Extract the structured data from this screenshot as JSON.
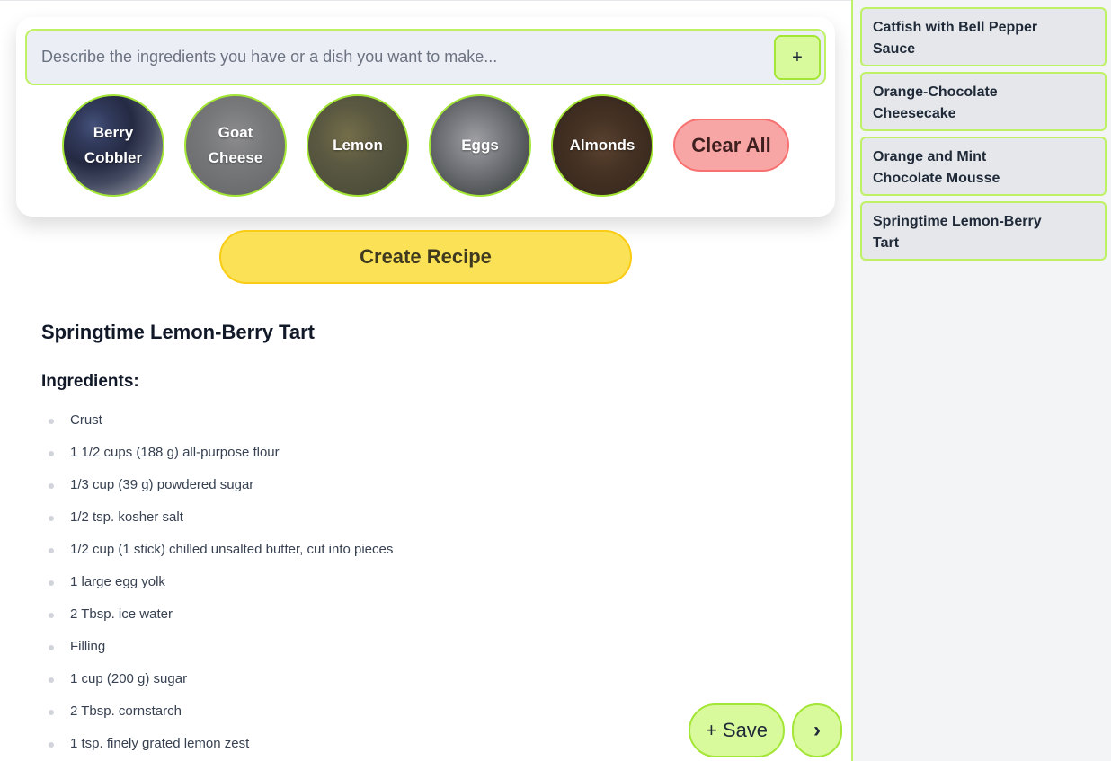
{
  "prompt": {
    "placeholder": "Describe the ingredients you have or a dish you want to make...",
    "add_label": "+"
  },
  "chips": [
    {
      "label": "Berry Cobbler",
      "icon": "berry-cobbler-photo"
    },
    {
      "label": "Goat Cheese",
      "icon": "goat-cheese-photo"
    },
    {
      "label": "Lemon",
      "icon": "lemon-photo"
    },
    {
      "label": "Eggs",
      "icon": "eggs-photo"
    },
    {
      "label": "Almonds",
      "icon": "almonds-photo"
    }
  ],
  "clear_all_label": "Clear All",
  "create_recipe_label": "Create Recipe",
  "recipe": {
    "title": "Springtime Lemon-Berry Tart",
    "ingredients_heading": "Ingredients:",
    "ingredients": [
      "Crust",
      "1 1/2 cups (188 g) all-purpose flour",
      "1/3 cup (39 g) powdered sugar",
      "1/2 tsp. kosher salt",
      "1/2 cup (1 stick) chilled unsalted butter, cut into pieces",
      "1 large egg yolk",
      "2 Tbsp. ice water",
      "Filling",
      "1 cup (200 g) sugar",
      "2 Tbsp. cornstarch",
      "1 tsp. finely grated lemon zest"
    ]
  },
  "actions": {
    "save_label": "+ Save",
    "next_label": "›"
  },
  "saved_recipes": [
    "Catfish with Bell Pepper Sauce",
    "Orange-Chocolate Cheesecake",
    "Orange and Mint Chocolate Mousse",
    "Springtime Lemon-Berry Tart"
  ],
  "colors": {
    "accent_green": "#bef264",
    "create_yellow": "#fae156",
    "clear_red": "#f8a5a5"
  }
}
